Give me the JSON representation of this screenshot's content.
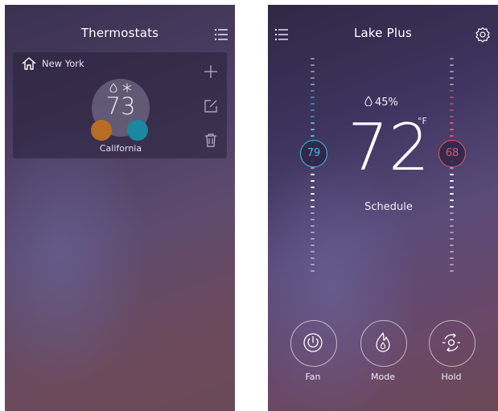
{
  "left_screen": {
    "title": "Thermostats",
    "card": {
      "location": "New York",
      "temperature": "73",
      "name": "California",
      "mode_icons": [
        "water-drop-icon",
        "snowflake-icon"
      ],
      "orange_color": "#b86d22",
      "blue_color": "#1a87a3"
    },
    "actions": [
      "plus-icon",
      "edit-icon",
      "trash-icon"
    ]
  },
  "right_screen": {
    "title": "Lake Plus",
    "humidity": "45%",
    "temperature": "72",
    "unit": "°F",
    "schedule_label": "Schedule",
    "cool_setpoint": "79",
    "heat_setpoint": "68",
    "cool_color": "#4fb6d6",
    "heat_color": "#e05a5a",
    "buttons": [
      {
        "label": "Fan",
        "icon": "power-icon"
      },
      {
        "label": "Mode",
        "icon": "flame-icon"
      },
      {
        "label": "Hold",
        "icon": "hold-icon"
      }
    ]
  }
}
